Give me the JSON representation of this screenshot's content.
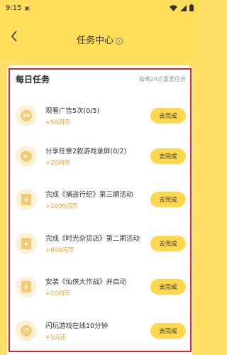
{
  "status_bar": {
    "time": "9:15"
  },
  "header": {
    "title": "任务中心",
    "info_glyph": "i"
  },
  "section": {
    "title": "每日任务",
    "note": "每晚24点重置任务"
  },
  "tasks": [
    {
      "icon": "ad-icon",
      "icon_text": "AD",
      "title": "观看广告5次(0/5)",
      "reward": "+50闪币",
      "button": "去完成"
    },
    {
      "icon": "play-icon",
      "icon_text": "▶",
      "title": "分享任意2款游戏录屏(0/2)",
      "reward": "+20闪币",
      "button": "去完成"
    },
    {
      "icon": "document-star-icon",
      "icon_text": "★",
      "title": "完成《捕盗行纪》第三期活动",
      "reward": "+1000闪币",
      "button": "去完成"
    },
    {
      "icon": "document-star-icon",
      "icon_text": "★",
      "title": "完成《时光杂货店》第二期活动",
      "reward": "+600闪币",
      "button": "去完成"
    },
    {
      "icon": "download-icon",
      "icon_text": "⬇",
      "title": "安装《仙侠大作战》并启动",
      "reward": "+10闪币",
      "button": "去完成"
    },
    {
      "icon": "clock-icon",
      "icon_text": "◔",
      "title": "闪玩游戏在线10分钟",
      "reward": "+5闪币",
      "button": "去完成"
    }
  ],
  "colors": {
    "header_bg": "#ffde59",
    "button_bg": "#ffd84d",
    "reward_text": "#f0a020",
    "icon_accent": "#f2cb72",
    "highlight_border": "#d9262f"
  }
}
